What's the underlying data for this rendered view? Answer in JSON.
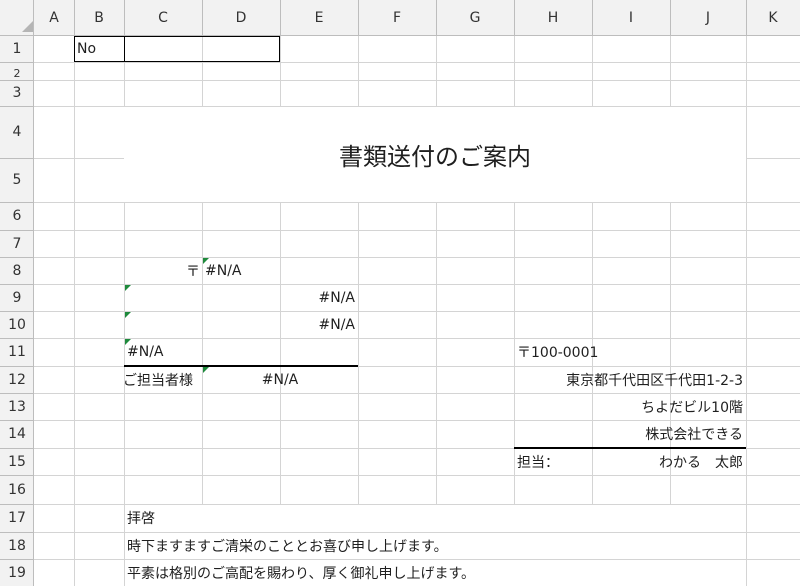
{
  "columns": [
    "A",
    "B",
    "C",
    "D",
    "E",
    "F",
    "G",
    "H",
    "I",
    "J",
    "K"
  ],
  "rows": [
    "1",
    "2",
    "3",
    "4",
    "5",
    "6",
    "7",
    "8",
    "9",
    "10",
    "11",
    "12",
    "13",
    "14",
    "15",
    "16",
    "17",
    "18",
    "19"
  ],
  "cells": {
    "b1_no": "No",
    "title": "書類送付のご案内",
    "recipient": {
      "postal_mark": "〒",
      "postal_value": "#N/A",
      "address1": "#N/A",
      "address2": "#N/A",
      "company": "#N/A",
      "contact_label": "ご担当者様",
      "contact_value": "#N/A"
    },
    "sender": {
      "postal": "〒100-0001",
      "address": "東京都千代田区千代田1-2-3",
      "building": "ちよだビル10階",
      "company": "株式会社できる",
      "person_label": "担当：",
      "person_name": "わかる　太郎"
    },
    "letter": {
      "salutation": "拝啓",
      "line1": "時下ますますご清栄のこととお喜び申し上げます。",
      "line2": "平素は格別のご高配を賜わり、厚く御礼申し上げます。"
    }
  },
  "colors": {
    "gridline": "#d4d4d4",
    "header_bg": "#f2f2f2",
    "error_indicator": "#1e8a3c"
  }
}
